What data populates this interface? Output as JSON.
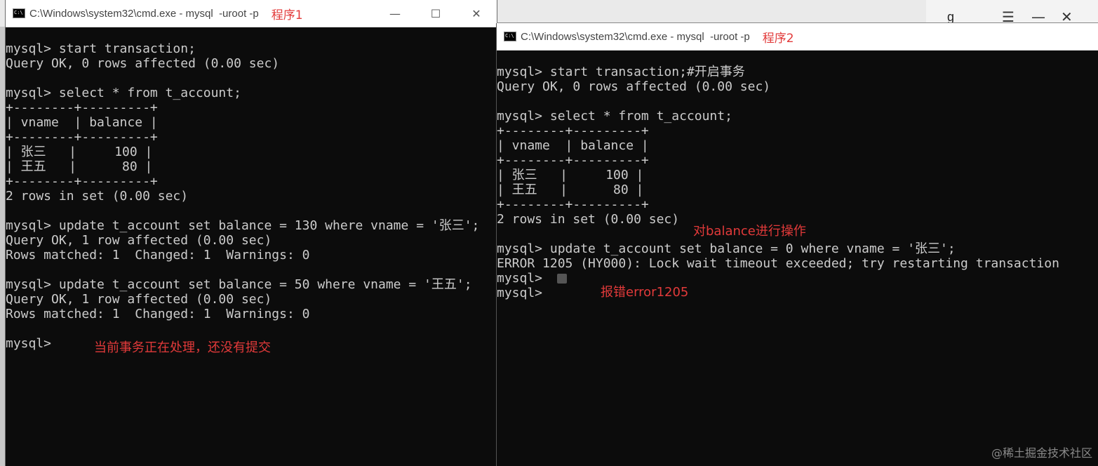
{
  "background_app": {
    "title_fragment": "g_",
    "icons": [
      "menu-icon",
      "minimize-icon",
      "close-icon"
    ]
  },
  "window1": {
    "title": "C:\\Windows\\system32\\cmd.exe - mysql  -uroot -p",
    "note": "程序1",
    "lines": [
      "",
      "mysql> start transaction;",
      "Query OK, 0 rows affected (0.00 sec)",
      "",
      "mysql> select * from t_account;",
      "+--------+---------+",
      "| vname  | balance |",
      "+--------+---------+",
      "| 张三   |     100 |",
      "| 王五   |      80 |",
      "+--------+---------+",
      "2 rows in set (0.00 sec)",
      "",
      "mysql> update t_account set balance = 130 where vname = '张三';",
      "Query OK, 1 row affected (0.00 sec)",
      "Rows matched: 1  Changed: 1  Warnings: 0",
      "",
      "mysql> update t_account set balance = 50 where vname = '王五';",
      "Query OK, 1 row affected (0.00 sec)",
      "Rows matched: 1  Changed: 1  Warnings: 0",
      "",
      "mysql>"
    ],
    "annotation": "当前事务正在处理，还没有提交"
  },
  "window2": {
    "title": "C:\\Windows\\system32\\cmd.exe - mysql  -uroot -p",
    "note": "程序2",
    "lines": [
      "",
      "mysql> start transaction;#开启事务",
      "Query OK, 0 rows affected (0.00 sec)",
      "",
      "mysql> select * from t_account;",
      "+--------+---------+",
      "| vname  | balance |",
      "+--------+---------+",
      "| 张三   |     100 |",
      "| 王五   |      80 |",
      "+--------+---------+",
      "2 rows in set (0.00 sec)",
      "",
      "mysql> update t_account set balance = 0 where vname = '张三';",
      "ERROR 1205 (HY000): Lock wait timeout exceeded; try restarting transaction",
      "mysql>",
      "mysql>"
    ],
    "annotation_op": "对balance进行操作",
    "annotation_err": "报错error1205"
  },
  "window_controls": {
    "minimize": "—",
    "maximize": "☐",
    "close": "✕"
  },
  "watermark": "@稀土掘金技术社区"
}
